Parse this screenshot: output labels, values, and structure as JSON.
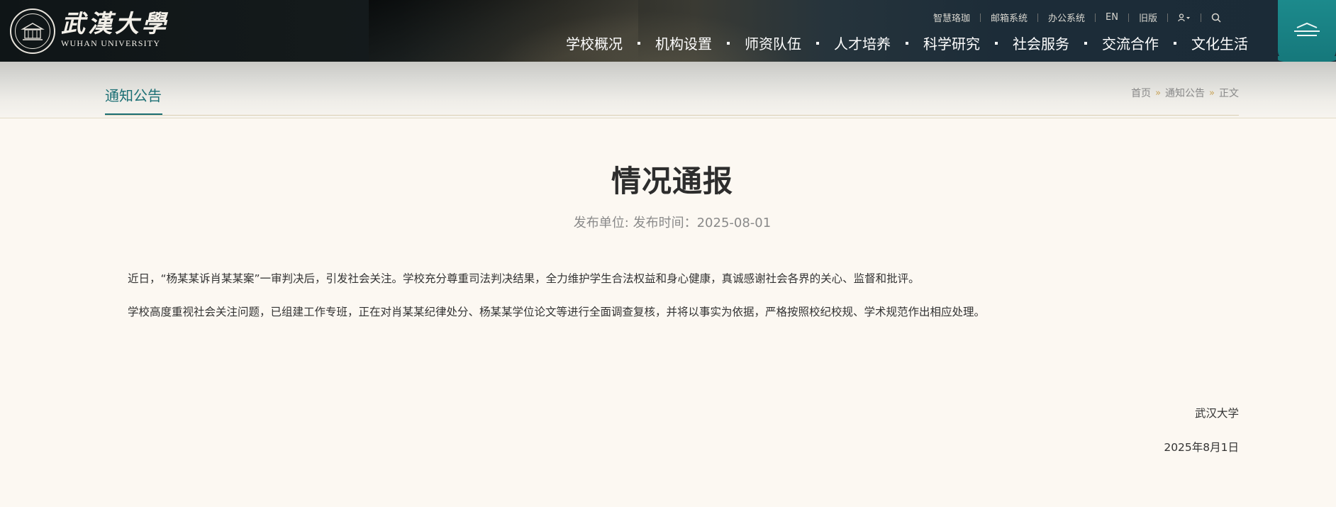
{
  "logo": {
    "cn": "武漢大學",
    "en": "WUHAN UNIVERSITY"
  },
  "toplinks": [
    {
      "label": "智慧珞珈"
    },
    {
      "label": "邮箱系统"
    },
    {
      "label": "办公系统"
    },
    {
      "label": "EN"
    },
    {
      "label": "旧版"
    }
  ],
  "icons": {
    "user": "user-icon",
    "search": "search-icon",
    "menu": "menu-icon"
  },
  "nav": [
    {
      "label": "学校概况"
    },
    {
      "label": "机构设置"
    },
    {
      "label": "师资队伍"
    },
    {
      "label": "人才培养"
    },
    {
      "label": "科学研究"
    },
    {
      "label": "社会服务"
    },
    {
      "label": "交流合作"
    },
    {
      "label": "文化生活"
    }
  ],
  "section": {
    "title": "通知公告"
  },
  "breadcrumb": {
    "home": "首页",
    "section": "通知公告",
    "current": "正文",
    "separator": "»"
  },
  "article": {
    "title": "情况通报",
    "meta": "发布单位:  发布时间：2025-08-01",
    "paragraphs": [
      "近日，“杨某某诉肖某某案”一审判决后，引发社会关注。学校充分尊重司法判决结果，全力维护学生合法权益和身心健康，真诚感谢社会各界的关心、监督和批评。",
      "学校高度重视社会关注问题，已组建工作专班，正在对肖某某纪律处分、杨某某学位论文等进行全面调查复核，并将以事实为依据，严格按照校纪校规、学术规范作出相应处理。"
    ],
    "signature": "武汉大学",
    "date": "2025年8月1日"
  },
  "colors": {
    "accent": "#1b6f74",
    "header_bg": "#151b1c",
    "page_bg": "#fcf8f2",
    "breadcrumb_arrow": "#c9a45a"
  }
}
